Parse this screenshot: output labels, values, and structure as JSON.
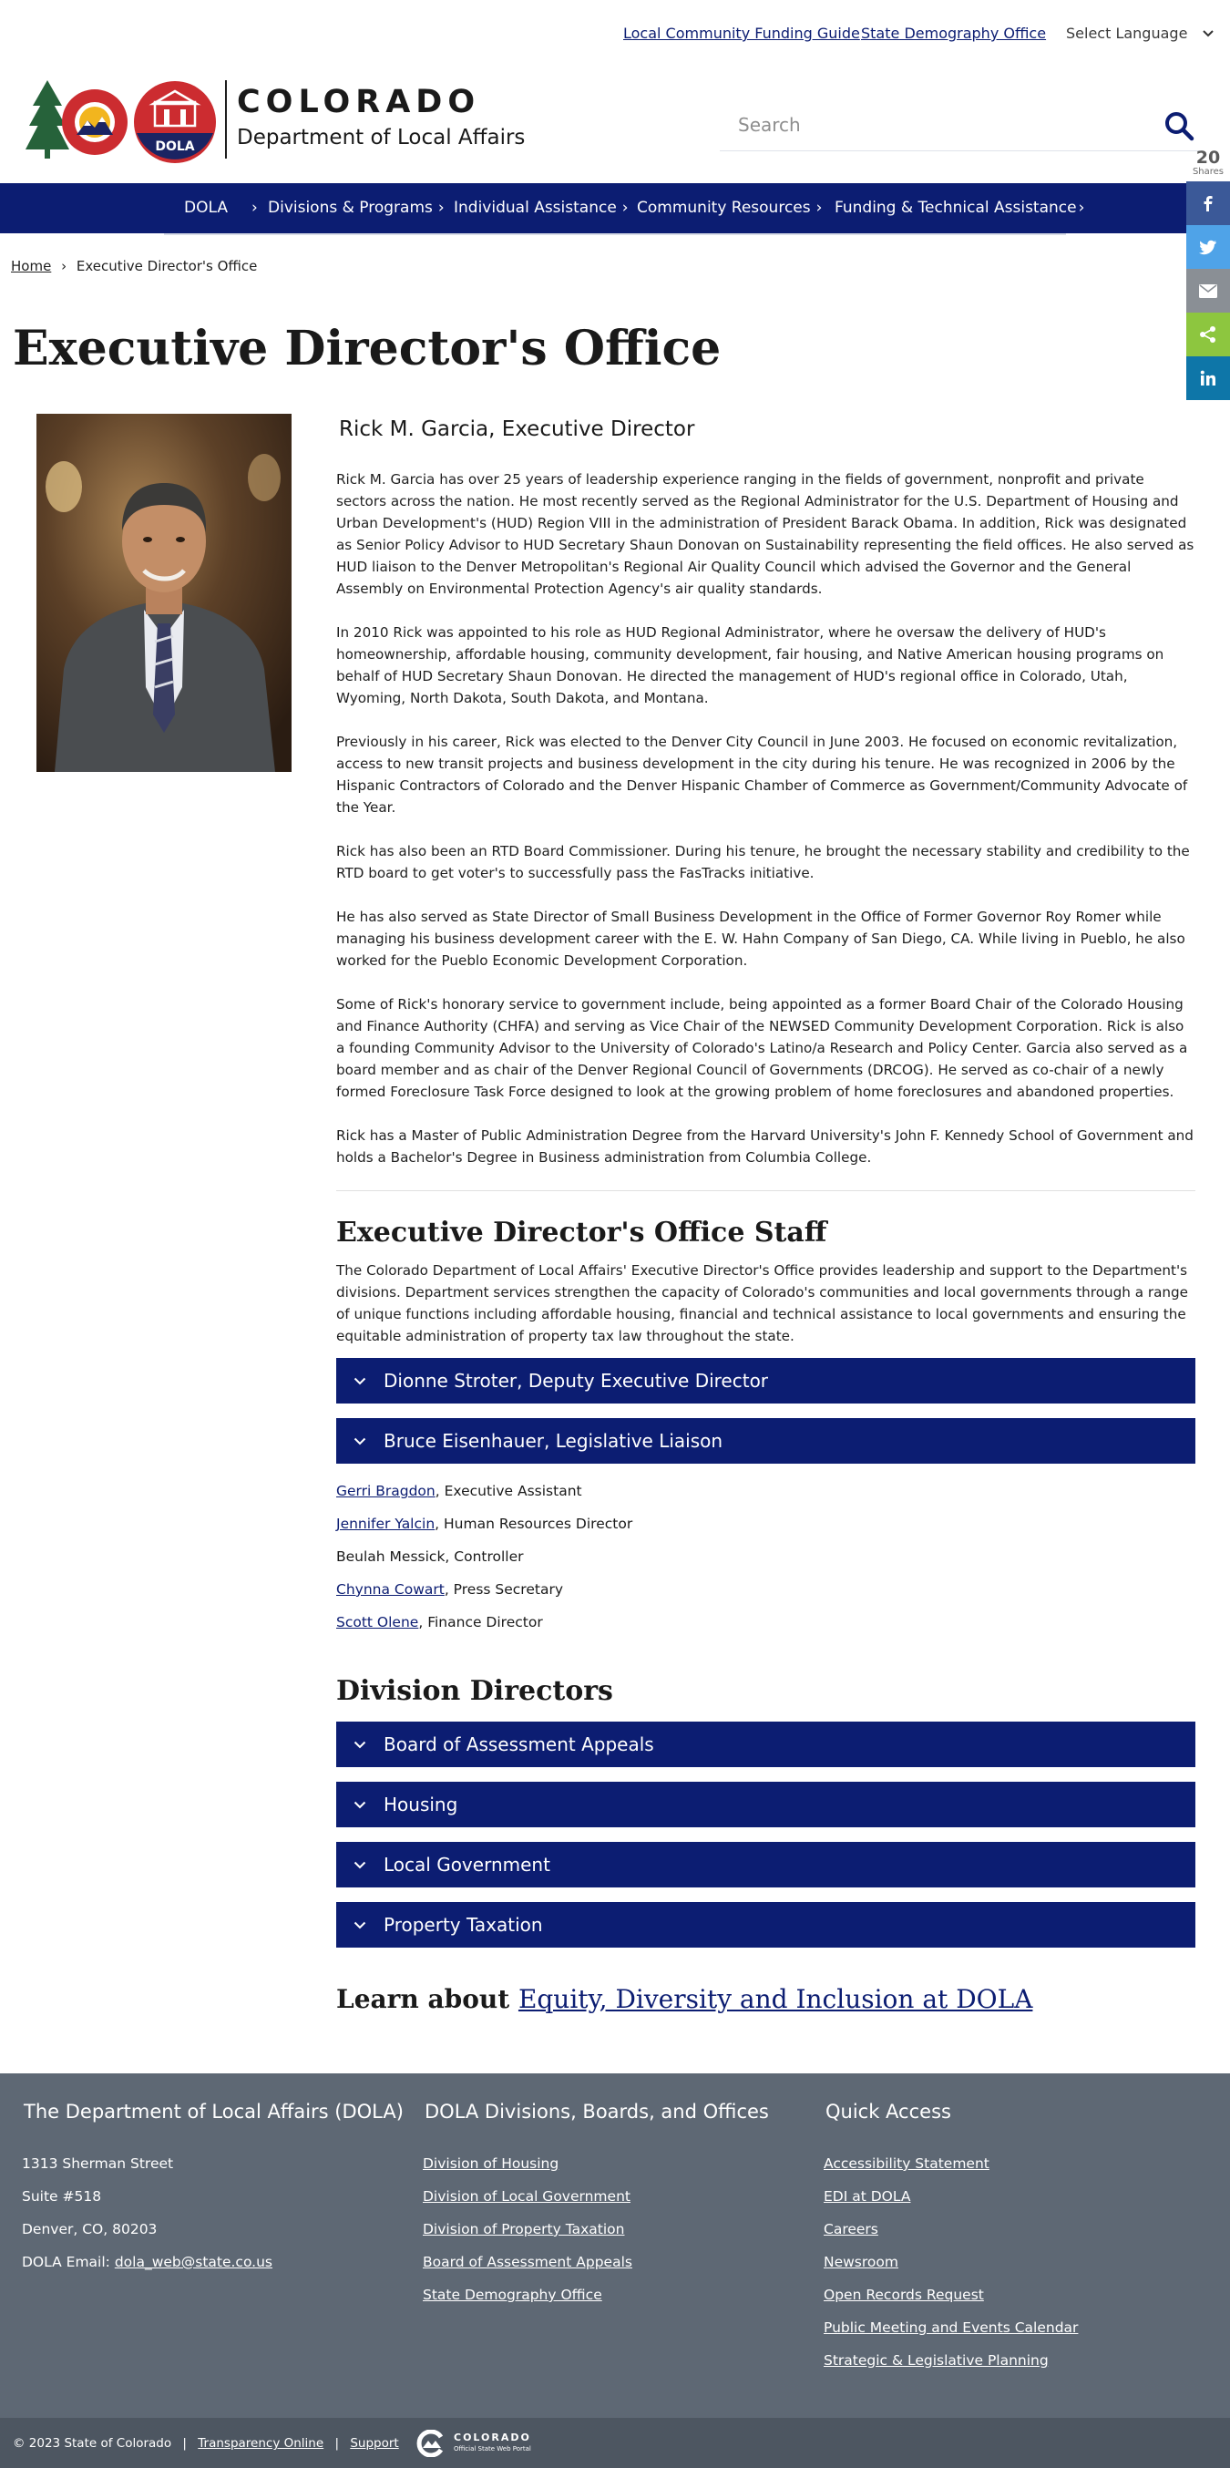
{
  "utility": {
    "link1": "Local Community Funding Guide",
    "link2": "State Demography Office",
    "language": "Select Language"
  },
  "header": {
    "logo_line1": "COLORADO",
    "logo_line2": "Department of Local Affairs",
    "logo_dola": "DOLA",
    "search_placeholder": "Search"
  },
  "share": {
    "count": "20",
    "label": "Shares"
  },
  "nav": [
    "DOLA",
    "Divisions & Programs",
    "Individual Assistance",
    "Community Resources",
    "Funding & Technical Assistance"
  ],
  "breadcrumb": {
    "home": "Home",
    "separator": "›",
    "current": "Executive Director's Office"
  },
  "page_title": "Executive Director's Office",
  "director": {
    "name": "Rick M. Garcia, Executive Director",
    "bio": [
      "Rick M. Garcia has over 25 years of leadership experience ranging in the fields of government, nonprofit and private sectors across the nation. He most recently served as the Regional Administrator for the U.S. Department of Housing and Urban Development's (HUD) Region VIII in the administration of President Barack Obama. In addition, Rick was designated as Senior Policy Advisor to HUD Secretary Shaun Donovan on Sustainability representing the field offices. He also served as HUD liaison to the Denver Metropolitan's Regional Air Quality Council which advised the Governor and the General Assembly on Environmental Protection Agency's air quality standards.",
      "In 2010 Rick was appointed to his role as HUD Regional Administrator, where he oversaw the delivery of HUD's homeownership, affordable housing, community development, fair housing, and Native American housing programs on behalf of HUD Secretary Shaun Donovan. He directed the management of HUD's regional office in Colorado, Utah, Wyoming, North Dakota, South Dakota, and Montana.",
      "Previously in his career, Rick was elected to the Denver City Council in June 2003. He focused on economic revitalization, access to new transit projects and business development in the city during his tenure. He was recognized in 2006 by the Hispanic Contractors of Colorado and the Denver Hispanic Chamber of Commerce as Government/Community Advocate of the Year.",
      "Rick has also been an RTD Board Commissioner. During his tenure, he brought the necessary stability and credibility to the RTD board to get voter's to successfully pass the FasTracks initiative.",
      "He has also served as State Director of Small Business Development in the Office of Former Governor Roy Romer while managing his business development career with the E. W. Hahn Company of San Diego, CA. While living in Pueblo, he also worked for the Pueblo Economic Development Corporation.",
      "Some of Rick's honorary service to government include, being appointed as a former Board Chair of the Colorado Housing and Finance Authority (CHFA) and serving as Vice Chair of the NEWSED Community Development Corporation. Rick is also a founding Community Advisor to the University of Colorado's Latino/a Research and Policy Center. Garcia also served as a board member and as chair of the Denver Regional Council of Governments (DRCOG). He served as co-chair of a newly formed Foreclosure Task Force designed to look at the growing problem of home foreclosures and abandoned properties.",
      "Rick has a Master of Public Administration Degree from the Harvard University's John F. Kennedy School of Government and holds a Bachelor's Degree in Business administration from Columbia College."
    ]
  },
  "staff_section": {
    "heading": "Executive Director's Office Staff",
    "intro": "The Colorado Department of Local Affairs' Executive Director's Office provides leadership and support to the Department's divisions. Department services strengthen the capacity of Colorado's communities and local governments through a range of unique functions including affordable housing, financial and technical assistance to local governments and ensuring the equitable administration of property tax law throughout the state.",
    "accordions": [
      "Dionne Stroter, Deputy Executive Director",
      "Bruce Eisenhauer, Legislative Liaison"
    ],
    "members": [
      {
        "name": "Gerri Bragdon",
        "role": ", Executive Assistant"
      },
      {
        "name": "Jennifer Yalcin",
        "role": ", Human Resources Director"
      },
      {
        "name": "Beulah Messick",
        "role": ", Controller"
      },
      {
        "name": "Chynna Cowart",
        "role": ", Press Secretary"
      },
      {
        "name": "Scott Olene",
        "role": ", Finance Director"
      }
    ]
  },
  "division_section": {
    "heading": "Division Directors",
    "accordions": [
      "Board of Assessment Appeals",
      "Housing",
      "Local Government",
      "Property Taxation"
    ]
  },
  "learn": {
    "prefix": "Learn about ",
    "link": "Equity, Diversity and Inclusion at DOLA"
  },
  "footer": {
    "col1": {
      "heading": "The Department of Local Affairs (DOLA)",
      "line1": "1313 Sherman Street",
      "line2": "Suite  #518",
      "line3": "Denver, CO, 80203",
      "email_label": "DOLA Email: ",
      "email": "dola_web@state.co.us"
    },
    "col2": {
      "heading": "DOLA Divisions, Boards, and Offices",
      "links": [
        "Division of Housing",
        "Division of Local Government",
        "Division of Property Taxation",
        "Board of Assessment Appeals",
        "State Demography Office"
      ]
    },
    "col3": {
      "heading": "Quick Access",
      "links": [
        "Accessibility Statement",
        "EDI at DOLA",
        "Careers",
        "Newsroom",
        "Open Records Request",
        "Public Meeting and Events Calendar",
        "Strategic & Legislative Planning"
      ]
    },
    "bottom": {
      "copyright": "© 2023 State of Colorado",
      "sep": "|",
      "link1": "Transparency Online",
      "link2": "Support",
      "portal_line1": "COLORADO",
      "portal_line2": "Official State Web Portal"
    }
  },
  "colors": {
    "navy": "#0c1d72",
    "footer": "#5e6874",
    "footer_bottom": "#4d5661"
  }
}
